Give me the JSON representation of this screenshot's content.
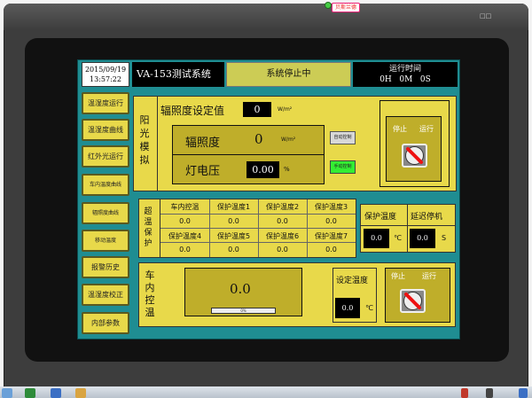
{
  "device": {
    "badge_text": "贝斯兰德",
    "corner_icon": "□□"
  },
  "header": {
    "date": "2015/09/19",
    "time": "13:57:22",
    "title": "VA-153测试系统",
    "status": "系统停止中",
    "runtime_label": "运行时间",
    "runtime_value": "0H   0M   0S"
  },
  "sidebar": {
    "items": [
      {
        "label": "温湿度运行"
      },
      {
        "label": "温湿度曲线"
      },
      {
        "label": "红外光运行"
      },
      {
        "label": "车内温度曲线"
      },
      {
        "label": "辐照度曲线"
      },
      {
        "label": "移动温度"
      },
      {
        "label": "报警历史"
      },
      {
        "label": "温湿度校正"
      },
      {
        "label": "内部参数"
      }
    ]
  },
  "solar": {
    "side_label": [
      "阳",
      "光",
      "模",
      "拟"
    ],
    "setpoint_label": "辐照度设定值",
    "setpoint_value": "0",
    "setpoint_unit": "W/m²",
    "irradiance_label": "辐照度",
    "irradiance_value": "0",
    "irradiance_unit": "W/m²",
    "lamp_voltage_label": "灯电压",
    "lamp_voltage_value": "0.00",
    "lamp_voltage_unit": "%",
    "auto_button": "自动控制",
    "manual_button": "手动控制",
    "stop_label": "停止",
    "run_label": "运行"
  },
  "overtemp": {
    "side_label": [
      "超",
      "温",
      "保",
      "护"
    ],
    "headers_row1": [
      "车内控温",
      "保护温度1",
      "保护温度2",
      "保护温度3"
    ],
    "values_row1": [
      "0.0",
      "0.0",
      "0.0",
      "0.0"
    ],
    "headers_row2": [
      "保护温度4",
      "保护温度5",
      "保护温度6",
      "保护温度7"
    ],
    "values_row2": [
      "0.0",
      "0.0",
      "0.0",
      "0.0"
    ],
    "protect_temp_label": "保护温度",
    "protect_temp_value": "0.0",
    "protect_temp_unit": "℃",
    "delay_stop_label": "延迟停机",
    "delay_stop_value": "0.0",
    "delay_stop_unit": "S"
  },
  "incar": {
    "side_label": [
      "车",
      "内",
      "控",
      "温"
    ],
    "display_value": "0.0",
    "bar_label": "0%",
    "set_temp_label": "设定温度",
    "set_temp_value": "0.0",
    "set_temp_unit": "℃",
    "stop_label": "停止",
    "run_label": "运行"
  }
}
